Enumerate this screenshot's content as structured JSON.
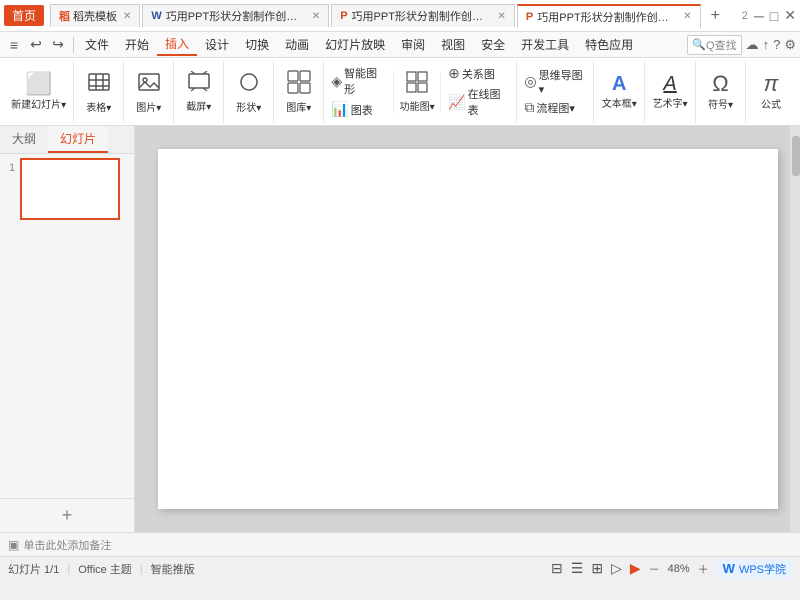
{
  "titleBar": {
    "homeBtn": "首页",
    "tabs": [
      {
        "id": "template",
        "icon": "稻",
        "iconColor": "#e04a1f",
        "label": "稻壳模板",
        "active": false
      },
      {
        "id": "docx",
        "icon": "W",
        "iconColor": "#2b579a",
        "label": "巧用PPT形状分割制作创意图片.docx",
        "active": false
      },
      {
        "id": "pptx1",
        "icon": "P",
        "iconColor": "#d04a20",
        "label": "巧用PPT形状分割制作创意图片.pptx",
        "active": false
      },
      {
        "id": "pptx2",
        "icon": "P",
        "iconColor": "#d04a20",
        "label": "巧用PPT形状分割制作创意图片.pptx",
        "active": true
      }
    ],
    "addTabBtn": "+",
    "windowNum": "2"
  },
  "menuBar": {
    "undoIcon": "↩",
    "redoIcon": "↪",
    "hamburgerIcon": "≡",
    "fileLabel": "文件",
    "tabs": [
      "开始",
      "插入",
      "设计",
      "切换",
      "动画",
      "幻灯片放映",
      "审阅",
      "视图",
      "安全",
      "开发工具",
      "特色应用"
    ],
    "activeTab": "插入",
    "searchPlaceholder": "Q查找",
    "menuIcons": [
      "↩",
      "↪"
    ]
  },
  "toolbar": {
    "groups": [
      {
        "id": "new-slide",
        "buttons": [
          {
            "id": "new-slide-btn",
            "icon": "🖼",
            "label": "新建幻灯片·",
            "large": true
          }
        ]
      },
      {
        "id": "table",
        "buttons": [
          {
            "id": "table-btn",
            "icon": "⊞",
            "label": "表格·",
            "large": true
          }
        ]
      },
      {
        "id": "image",
        "buttons": [
          {
            "id": "image-btn",
            "icon": "🖼",
            "label": "图片·",
            "large": true
          }
        ]
      },
      {
        "id": "screenshot",
        "buttons": [
          {
            "id": "screenshot-btn",
            "icon": "✂",
            "label": "截屏·",
            "large": true
          }
        ]
      },
      {
        "id": "shape",
        "buttons": [
          {
            "id": "shape-btn",
            "icon": "○",
            "label": "形状·",
            "large": true
          }
        ]
      },
      {
        "id": "chart-lib",
        "buttons": [
          {
            "id": "chart-lib-btn",
            "icon": "▦",
            "label": "图库·",
            "large": true
          }
        ]
      },
      {
        "id": "function",
        "buttons": [
          {
            "id": "smart-shape-btn",
            "icon": "◈",
            "label": "智能图形",
            "large": false
          },
          {
            "id": "chart-btn",
            "icon": "📊",
            "label": "图表",
            "large": false
          },
          {
            "id": "function-btn",
            "icon": "▣",
            "label": "功能图·",
            "large": true
          },
          {
            "id": "relation-btn",
            "icon": "⊕",
            "label": "关系图",
            "large": false
          },
          {
            "id": "online-chart-btn",
            "icon": "📈",
            "label": "在线图表",
            "large": false
          }
        ]
      },
      {
        "id": "mindmap",
        "buttons": [
          {
            "id": "mindmap-btn",
            "icon": "◎",
            "label": "思维导图·",
            "large": true
          },
          {
            "id": "flowchart-btn",
            "icon": "⧈",
            "label": "流程图·",
            "large": true
          }
        ]
      },
      {
        "id": "textbox",
        "buttons": [
          {
            "id": "textbox-btn",
            "icon": "A",
            "label": "文本框·",
            "large": true
          }
        ]
      },
      {
        "id": "arttext",
        "buttons": [
          {
            "id": "arttext-btn",
            "icon": "A̲",
            "label": "艺术字·",
            "large": true
          }
        ]
      },
      {
        "id": "symbol",
        "buttons": [
          {
            "id": "symbol-btn",
            "icon": "Ω",
            "label": "符号·",
            "large": true
          }
        ]
      },
      {
        "id": "formula",
        "buttons": [
          {
            "id": "formula-btn",
            "icon": "π",
            "label": "公式",
            "large": true
          }
        ]
      }
    ]
  },
  "leftPanel": {
    "tabs": [
      "大纲",
      "幻灯片"
    ],
    "activeTab": "幻灯片",
    "slides": [
      {
        "num": "1"
      }
    ],
    "addBtn": "+"
  },
  "canvas": {
    "empty": true
  },
  "notesBar": {
    "icon": "▣",
    "text": "单击此处添加备注"
  },
  "statusBar": {
    "slideInfo": "幻灯片 1/1",
    "theme": "Office 主题",
    "aiLabel": "智能推版",
    "zoomLevel": "48%",
    "wpsLabel": "WPS学院"
  }
}
